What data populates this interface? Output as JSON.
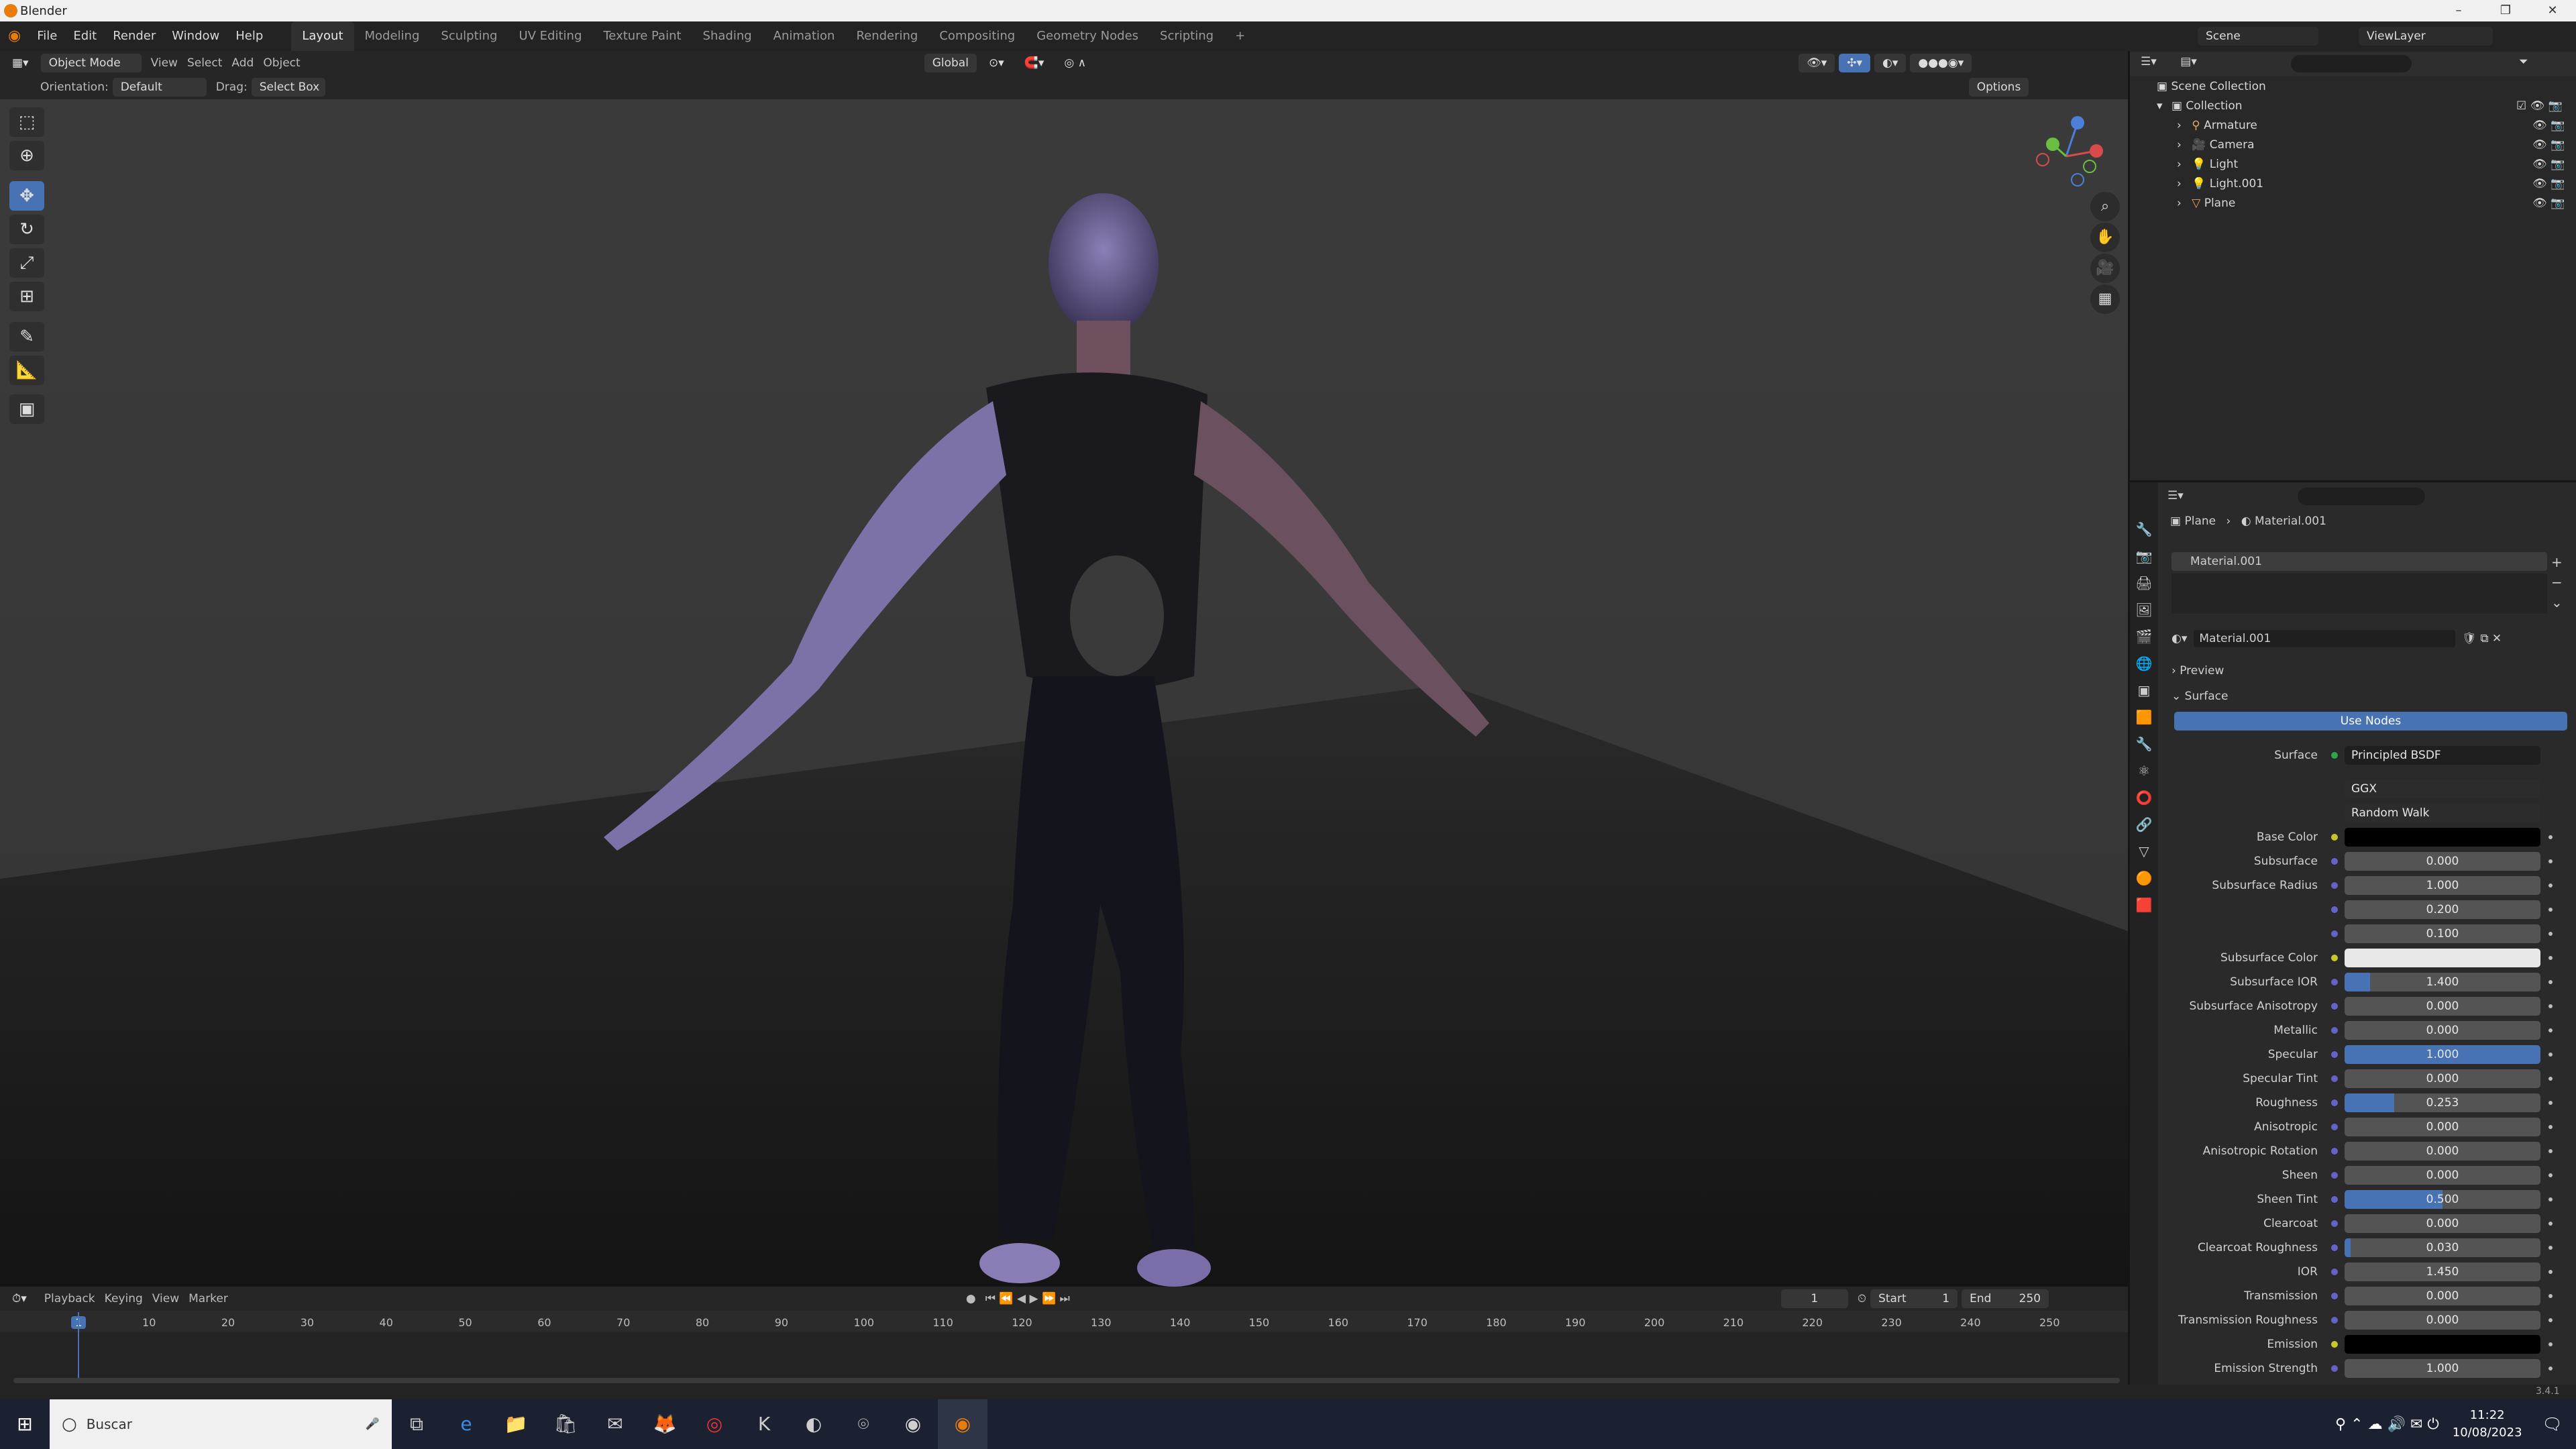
{
  "window": {
    "title": "Blender"
  },
  "menu": {
    "items": [
      "File",
      "Edit",
      "Render",
      "Window",
      "Help"
    ]
  },
  "workspaces": {
    "active": "Layout",
    "tabs": [
      "Layout",
      "Modeling",
      "Sculpting",
      "UV Editing",
      "Texture Paint",
      "Shading",
      "Animation",
      "Rendering",
      "Compositing",
      "Geometry Nodes",
      "Scripting"
    ]
  },
  "topright": {
    "scene": "Scene",
    "viewlayer": "ViewLayer"
  },
  "viewport_header": {
    "mode": "Object Mode",
    "menus": [
      "View",
      "Select",
      "Add",
      "Object"
    ],
    "transform": "Global",
    "options": "Options"
  },
  "tool_settings": {
    "orientation_label": "Orientation:",
    "orientation_value": "Default",
    "drag_label": "Drag:",
    "drag_value": "Select Box"
  },
  "outliner": {
    "root": "Scene Collection",
    "collection": "Collection",
    "objects": [
      "Armature",
      "Camera",
      "Light",
      "Light.001",
      "Plane"
    ]
  },
  "properties": {
    "breadcrumb": {
      "object": "Plane",
      "material": "Material.001"
    },
    "slot": "Material.001",
    "material_name": "Material.001",
    "panels": {
      "preview": "Preview",
      "surface": "Surface"
    },
    "use_nodes": "Use Nodes",
    "surface_label": "Surface",
    "surface_value": "Principled BSDF",
    "distribution": "GGX",
    "subsurface_method": "Random Walk",
    "rows": [
      {
        "label": "Base Color",
        "type": "color",
        "color": "#000000",
        "socket": "y"
      },
      {
        "label": "Subsurface",
        "value": "0.000",
        "fill": 0
      },
      {
        "label": "Subsurface Radius",
        "value": "1.000",
        "fill": 0
      },
      {
        "label": "",
        "value": "0.200",
        "fill": 0
      },
      {
        "label": "",
        "value": "0.100",
        "fill": 0
      },
      {
        "label": "Subsurface Color",
        "type": "color",
        "color": "#e8e8e8",
        "socket": "y"
      },
      {
        "label": "Subsurface IOR",
        "value": "1.400",
        "fill": 0.13
      },
      {
        "label": "Subsurface Anisotropy",
        "value": "0.000",
        "fill": 0
      },
      {
        "label": "Metallic",
        "value": "0.000",
        "fill": 0
      },
      {
        "label": "Specular",
        "value": "1.000",
        "fill": 1
      },
      {
        "label": "Specular Tint",
        "value": "0.000",
        "fill": 0
      },
      {
        "label": "Roughness",
        "value": "0.253",
        "fill": 0.253
      },
      {
        "label": "Anisotropic",
        "value": "0.000",
        "fill": 0
      },
      {
        "label": "Anisotropic Rotation",
        "value": "0.000",
        "fill": 0
      },
      {
        "label": "Sheen",
        "value": "0.000",
        "fill": 0
      },
      {
        "label": "Sheen Tint",
        "value": "0.500",
        "fill": 0.5
      },
      {
        "label": "Clearcoat",
        "value": "0.000",
        "fill": 0
      },
      {
        "label": "Clearcoat Roughness",
        "value": "0.030",
        "fill": 0.03
      },
      {
        "label": "IOR",
        "value": "1.450",
        "fill": 0
      },
      {
        "label": "Transmission",
        "value": "0.000",
        "fill": 0
      },
      {
        "label": "Transmission Roughness",
        "value": "0.000",
        "fill": 0
      },
      {
        "label": "Emission",
        "type": "color",
        "color": "#000000",
        "socket": "y"
      },
      {
        "label": "Emission Strength",
        "value": "1.000",
        "fill": 0
      }
    ]
  },
  "timeline": {
    "menus": [
      "Playback",
      "Keying",
      "View",
      "Marker"
    ],
    "current_frame": "1",
    "start_label": "Start",
    "start": "1",
    "end_label": "End",
    "end": "250",
    "ticks": [
      "1",
      "10",
      "20",
      "30",
      "40",
      "50",
      "60",
      "70",
      "80",
      "90",
      "100",
      "110",
      "120",
      "130",
      "140",
      "150",
      "160",
      "170",
      "180",
      "190",
      "200",
      "210",
      "220",
      "230",
      "240",
      "250"
    ]
  },
  "status": {
    "version": "3.4.1"
  },
  "taskbar": {
    "search_placeholder": "Buscar",
    "time": "11:22",
    "date": "10/08/2023"
  }
}
